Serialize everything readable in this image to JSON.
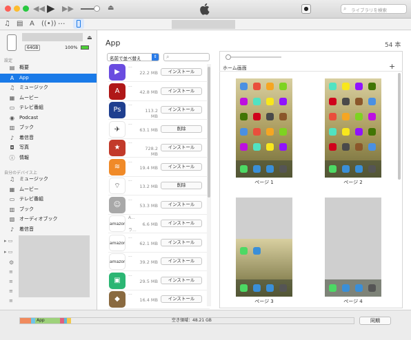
{
  "titlebar": {
    "search_placeholder": "ライブラリを検索"
  },
  "device": {
    "capacity": "64GB",
    "battery": "100%"
  },
  "sidebar": {
    "settings_header": "設定",
    "settings_items": [
      {
        "label": "概要",
        "icon": "summary-icon"
      },
      {
        "label": "App",
        "icon": "app-icon",
        "selected": true
      },
      {
        "label": "ミュージック",
        "icon": "music-icon"
      },
      {
        "label": "ムービー",
        "icon": "movie-icon"
      },
      {
        "label": "テレビ番組",
        "icon": "tv-icon"
      },
      {
        "label": "Podcast",
        "icon": "podcast-icon"
      },
      {
        "label": "ブック",
        "icon": "book-icon"
      },
      {
        "label": "着信音",
        "icon": "bell-icon"
      },
      {
        "label": "写真",
        "icon": "camera-icon"
      },
      {
        "label": "情報",
        "icon": "info-icon"
      }
    ],
    "ondevice_header": "自分のデバイス上",
    "ondevice_items": [
      {
        "label": "ミュージック",
        "icon": "music-icon"
      },
      {
        "label": "ムービー",
        "icon": "movie-icon"
      },
      {
        "label": "テレビ番組",
        "icon": "tv-icon"
      },
      {
        "label": "ブック",
        "icon": "book-icon"
      },
      {
        "label": "オーディオブック",
        "icon": "audiobook-icon"
      },
      {
        "label": "着信音",
        "icon": "bell-icon"
      }
    ]
  },
  "main": {
    "title": "App",
    "count": "54 本",
    "sort_label": "名前で並べ替え",
    "home_screen_label": "ホーム画面",
    "add_symbol": "+",
    "apps": [
      {
        "name": "...",
        "size": "22.2 MB",
        "action": "インストール",
        "color": "#6a4ce0",
        "glyph": "▶"
      },
      {
        "name": "...",
        "size": "42.8 MB",
        "action": "インストール",
        "color": "#b01818",
        "glyph": "A"
      },
      {
        "name": "...",
        "size": "113.2 MB",
        "action": "インストール",
        "color": "#1f3f8f",
        "glyph": "Ps"
      },
      {
        "name": "...",
        "size": "63.1 MB",
        "action": "削除",
        "color": "#ffffff",
        "glyph": "✈"
      },
      {
        "name": "...",
        "size": "728.2 MB",
        "action": "インストール",
        "color": "#c23a2a",
        "glyph": "★"
      },
      {
        "name": "...",
        "size": "19.4 MB",
        "action": "インストール",
        "color": "#f08a28",
        "glyph": "≋"
      },
      {
        "name": "...",
        "size": "13.2 MB",
        "action": "削除",
        "color": "#ffffff",
        "glyph": "⌔"
      },
      {
        "name": "...",
        "size": "53.3 MB",
        "action": "インストール",
        "color": "#a8a8a8",
        "glyph": "☺"
      },
      {
        "name": "A...",
        "size": "6.6 MB",
        "action": "インストール",
        "color": "#ffffff",
        "glyph": "amazon",
        "extra": "ラ..."
      },
      {
        "name": "...",
        "size": "62.1 MB",
        "action": "インストール",
        "color": "#ffffff",
        "glyph": "amazon"
      },
      {
        "name": "...",
        "size": "39.2 MB",
        "action": "インストール",
        "color": "#ffffff",
        "glyph": "amazon"
      },
      {
        "name": "...",
        "size": "29.5 MB",
        "action": "インストール",
        "color": "#2bb673",
        "glyph": "▣"
      },
      {
        "name": "...",
        "size": "16.4 MB",
        "action": "インストール",
        "color": "#8a6a40",
        "glyph": "◆"
      }
    ],
    "pages": [
      {
        "label": "ページ 1"
      },
      {
        "label": "ページ 2"
      },
      {
        "label": "ページ 3"
      },
      {
        "label": "ページ 4"
      }
    ]
  },
  "storage": {
    "app_label": "App",
    "free_label": "空き領域：48.21 GB",
    "sync_button": "同期"
  }
}
